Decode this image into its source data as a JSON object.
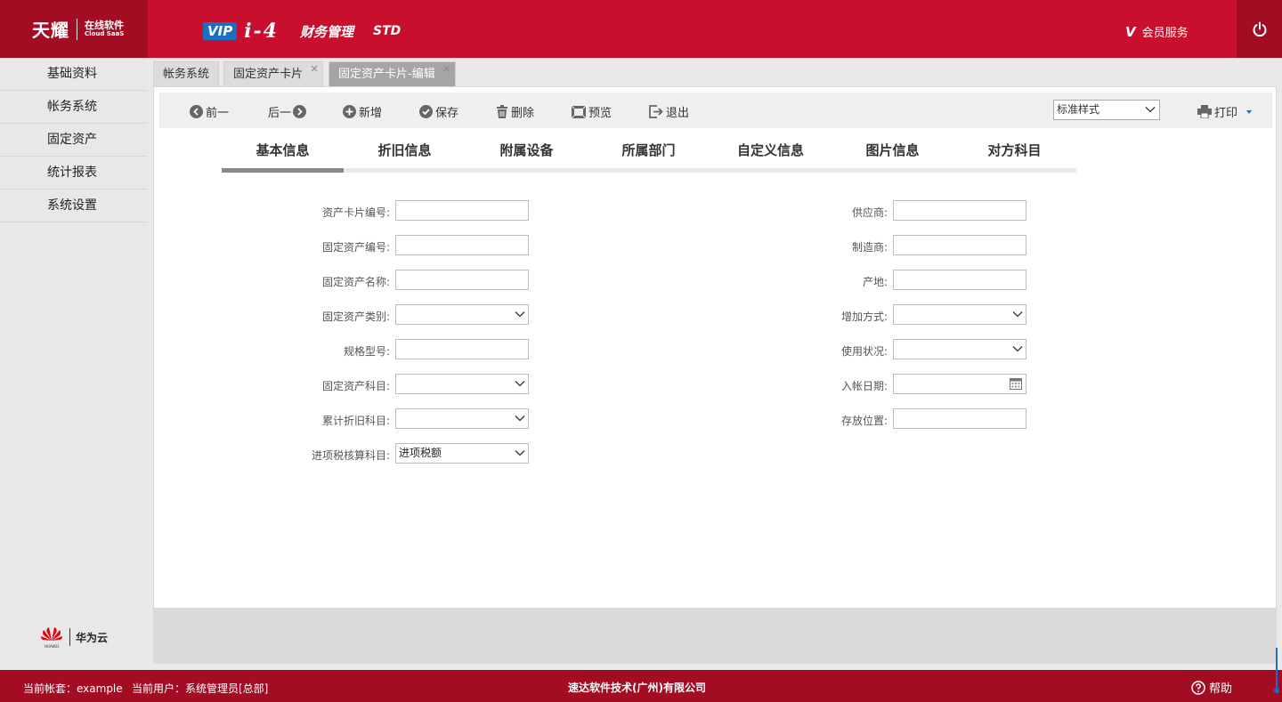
{
  "header": {
    "brand_cn": "天耀",
    "brand_sub_cn": "在线软件",
    "brand_sub_en": "Cloud SaaS",
    "vip": "VIP",
    "product": "i-4",
    "module": "财务管理",
    "edition": "STD",
    "member_v": "V",
    "member": "会员服务"
  },
  "sidebar": {
    "items": [
      {
        "label": "基础资料"
      },
      {
        "label": "帐务系统"
      },
      {
        "label": "固定资产"
      },
      {
        "label": "统计报表"
      },
      {
        "label": "系统设置"
      }
    ],
    "partner_logo": "HUAWEI",
    "partner_name": "华为云"
  },
  "tabs": [
    {
      "label": "帐务系统"
    },
    {
      "label": "固定资产卡片",
      "close": "×"
    },
    {
      "label": "固定资产卡片-编辑",
      "close": "×"
    }
  ],
  "toolbar": {
    "prev": "前一",
    "next": "后一",
    "add": "新增",
    "save": "保存",
    "delete": "删除",
    "preview": "预览",
    "exit": "退出",
    "style_select": "标准样式",
    "print": "打印"
  },
  "subtabs": [
    {
      "label": "基本信息"
    },
    {
      "label": "折旧信息"
    },
    {
      "label": "附属设备"
    },
    {
      "label": "所属部门"
    },
    {
      "label": "自定义信息"
    },
    {
      "label": "图片信息"
    },
    {
      "label": "对方科目"
    }
  ],
  "form": {
    "left": [
      {
        "label": "资产卡片编号:",
        "value": ""
      },
      {
        "label": "固定资产编号:",
        "value": ""
      },
      {
        "label": "固定资产名称:",
        "value": ""
      },
      {
        "label": "固定资产类别:",
        "value": ""
      },
      {
        "label": "规格型号:",
        "value": ""
      },
      {
        "label": "固定资产科目:",
        "value": ""
      },
      {
        "label": "累计折旧科目:",
        "value": ""
      },
      {
        "label": "进项税核算科目:",
        "value": "进项税额"
      }
    ],
    "right": [
      {
        "label": "供应商:",
        "value": ""
      },
      {
        "label": "制造商:",
        "value": ""
      },
      {
        "label": "产地:",
        "value": ""
      },
      {
        "label": "增加方式:",
        "value": ""
      },
      {
        "label": "使用状况:",
        "value": ""
      },
      {
        "label": "入帐日期:",
        "value": ""
      },
      {
        "label": "存放位置:",
        "value": ""
      }
    ]
  },
  "footer": {
    "account": "当前帐套：example",
    "user": "当前用户：系统管理员[总部]",
    "company": "速达软件技术(广州)有限公司",
    "help": "帮助"
  },
  "colors": {
    "brand_red": "#c8102e",
    "dark_red": "#a30d24",
    "vip_blue": "#1a6fc2"
  }
}
